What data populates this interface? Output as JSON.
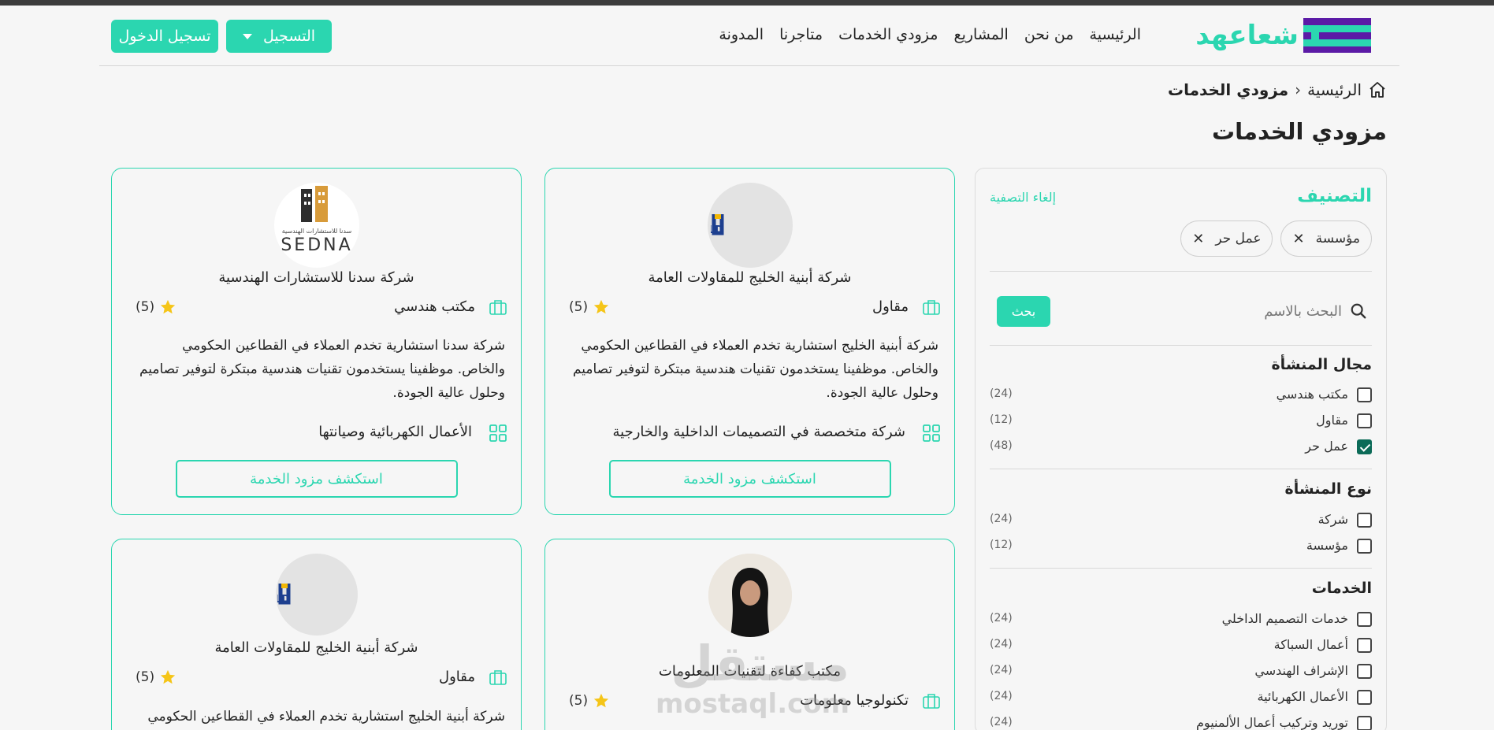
{
  "header": {
    "logo_text": "شعاعهد",
    "nav": [
      "الرئيسية",
      "من نحن",
      "المشاريع",
      "مزودي الخدمات",
      "متاجرنا",
      "المدونة"
    ],
    "register_label": "التسجيل",
    "login_label": "تسجيل الدخول"
  },
  "breadcrumb": {
    "home": "الرئيسية",
    "current": "مزودي الخدمات"
  },
  "page_title": "مزودي الخدمات",
  "filter": {
    "title": "التصنيف",
    "clear_label": "إلغاء التصفية",
    "chips": [
      "مؤسسة",
      "عمل حر"
    ],
    "search_placeholder": "البحث بالاسم",
    "search_button": "بحث",
    "sections": [
      {
        "title": "مجال المنشأة",
        "options": [
          {
            "label": "مكتب هندسي",
            "count": "(24)",
            "checked": false
          },
          {
            "label": "مقاول",
            "count": "(12)",
            "checked": false
          },
          {
            "label": "عمل حر",
            "count": "(48)",
            "checked": true
          }
        ]
      },
      {
        "title": "نوع المنشأة",
        "options": [
          {
            "label": "شركة",
            "count": "(24)",
            "checked": false
          },
          {
            "label": "مؤسسة",
            "count": "(12)",
            "checked": false
          }
        ]
      },
      {
        "title": "الخدمات",
        "options": [
          {
            "label": "خدمات التصميم الداخلي",
            "count": "(24)",
            "checked": false
          },
          {
            "label": "أعمال السباكة",
            "count": "(24)",
            "checked": false
          },
          {
            "label": "الإشراف الهندسي",
            "count": "(24)",
            "checked": false
          },
          {
            "label": "الأعمال الكهربائية",
            "count": "(24)",
            "checked": false
          },
          {
            "label": "توريد وتركيب أعمال الألمنيوم",
            "count": "(24)",
            "checked": false
          }
        ]
      }
    ]
  },
  "cards": [
    {
      "name": "شركة أبنية الخليج للمقاولات العامة",
      "kind": "مقاول",
      "rating": "(5)",
      "logo": "GULFBUILD",
      "desc": "شركة أبنية الخليج استشارية تخدم العملاء في القطاعين الحكومي والخاص. موظفينا يستخدمون تقنيات هندسية مبتكرة لتوفير تصاميم وحلول عالية الجودة.",
      "specialty": "شركة متخصصة في التصميمات الداخلية والخارجية",
      "button": "استكشف مزود الخدمة"
    },
    {
      "name": "شركة سدنا للاستشارات الهندسية",
      "kind": "مكتب هندسي",
      "rating": "(5)",
      "logo": "SEDNA",
      "logo_sub": "سدنا للاستشارات الهندسية",
      "desc": "شركة سدنا استشارية تخدم العملاء في القطاعين الحكومي والخاص. موظفينا يستخدمون تقنيات هندسية مبتكرة لتوفير تصاميم وحلول عالية الجودة.",
      "specialty": "الأعمال الكهربائية وصيانتها",
      "button": "استكشف مزود الخدمة"
    },
    {
      "name": "مكتب كفاءة لتقنيات المعلومات",
      "kind": "تكنولوجيا معلومات",
      "rating": "(5)"
    },
    {
      "name": "شركة أبنية الخليج للمقاولات العامة",
      "kind": "مقاول",
      "rating": "(5)",
      "logo": "GULFBUILD",
      "desc": "شركة أبنية الخليج استشارية تخدم العملاء في القطاعين الحكومي"
    }
  ],
  "watermark": {
    "ar": "مستقل",
    "en": "mostaql.com"
  },
  "colors": {
    "accent": "#2bd6b0",
    "brand_purple": "#5b1aa6",
    "checked": "#0c6b58",
    "star": "#f5c518"
  }
}
